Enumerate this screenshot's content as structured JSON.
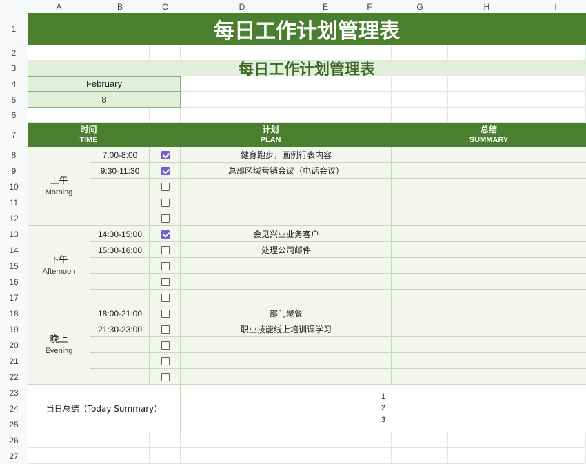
{
  "columns": [
    "A",
    "B",
    "C",
    "D",
    "E",
    "F",
    "G",
    "H",
    "I"
  ],
  "rows": [
    "1",
    "2",
    "3",
    "4",
    "5",
    "6",
    "7",
    "8",
    "9",
    "10",
    "11",
    "12",
    "13",
    "14",
    "15",
    "16",
    "17",
    "18",
    "19",
    "20",
    "21",
    "22",
    "23",
    "24",
    "25",
    "26",
    "27"
  ],
  "title": "每日工作计划管理表",
  "subtitle": "每日工作计划管理表",
  "month": "February",
  "day": "8",
  "header": {
    "time_cn": "时间",
    "time_en": "TIME",
    "plan_cn": "计划",
    "plan_en": "PLAN",
    "summary_cn": "总结",
    "summary_en": "SUMMARY"
  },
  "periods": [
    {
      "cn": "上午",
      "en": "Morning"
    },
    {
      "cn": "下午",
      "en": "Afternoon"
    },
    {
      "cn": "晚上",
      "en": "Evening"
    }
  ],
  "entries": [
    {
      "time": "7:00-8:00",
      "checked": true,
      "plan": "健身跑步，画例行表内容"
    },
    {
      "time": "9:30-11:30",
      "checked": true,
      "plan": "总部区域营销会议（电话会议）"
    },
    {
      "time": "",
      "checked": false,
      "plan": ""
    },
    {
      "time": "",
      "checked": false,
      "plan": ""
    },
    {
      "time": "",
      "checked": false,
      "plan": ""
    },
    {
      "time": "14:30-15:00",
      "checked": true,
      "plan": "会见兴业业务客户"
    },
    {
      "time": "15:30-16:00",
      "checked": false,
      "plan": "处理公司邮件"
    },
    {
      "time": "",
      "checked": false,
      "plan": ""
    },
    {
      "time": "",
      "checked": false,
      "plan": ""
    },
    {
      "time": "",
      "checked": false,
      "plan": ""
    },
    {
      "time": "18:00-21:00",
      "checked": false,
      "plan": "部门聚餐"
    },
    {
      "time": "21:30-23:00",
      "checked": false,
      "plan": "职业技能线上培训课学习"
    },
    {
      "time": "",
      "checked": false,
      "plan": ""
    },
    {
      "time": "",
      "checked": false,
      "plan": ""
    },
    {
      "time": "",
      "checked": false,
      "plan": ""
    }
  ],
  "today_summary_label": "当日总结（Today Summary）",
  "today_summary_items": [
    "1",
    "2",
    "3"
  ],
  "colors": {
    "header_green": "#4a7f2f",
    "light_green": "#e2efda",
    "row_fill": "#f3f6ef",
    "checkbox_checked": "#7b5ec9"
  }
}
